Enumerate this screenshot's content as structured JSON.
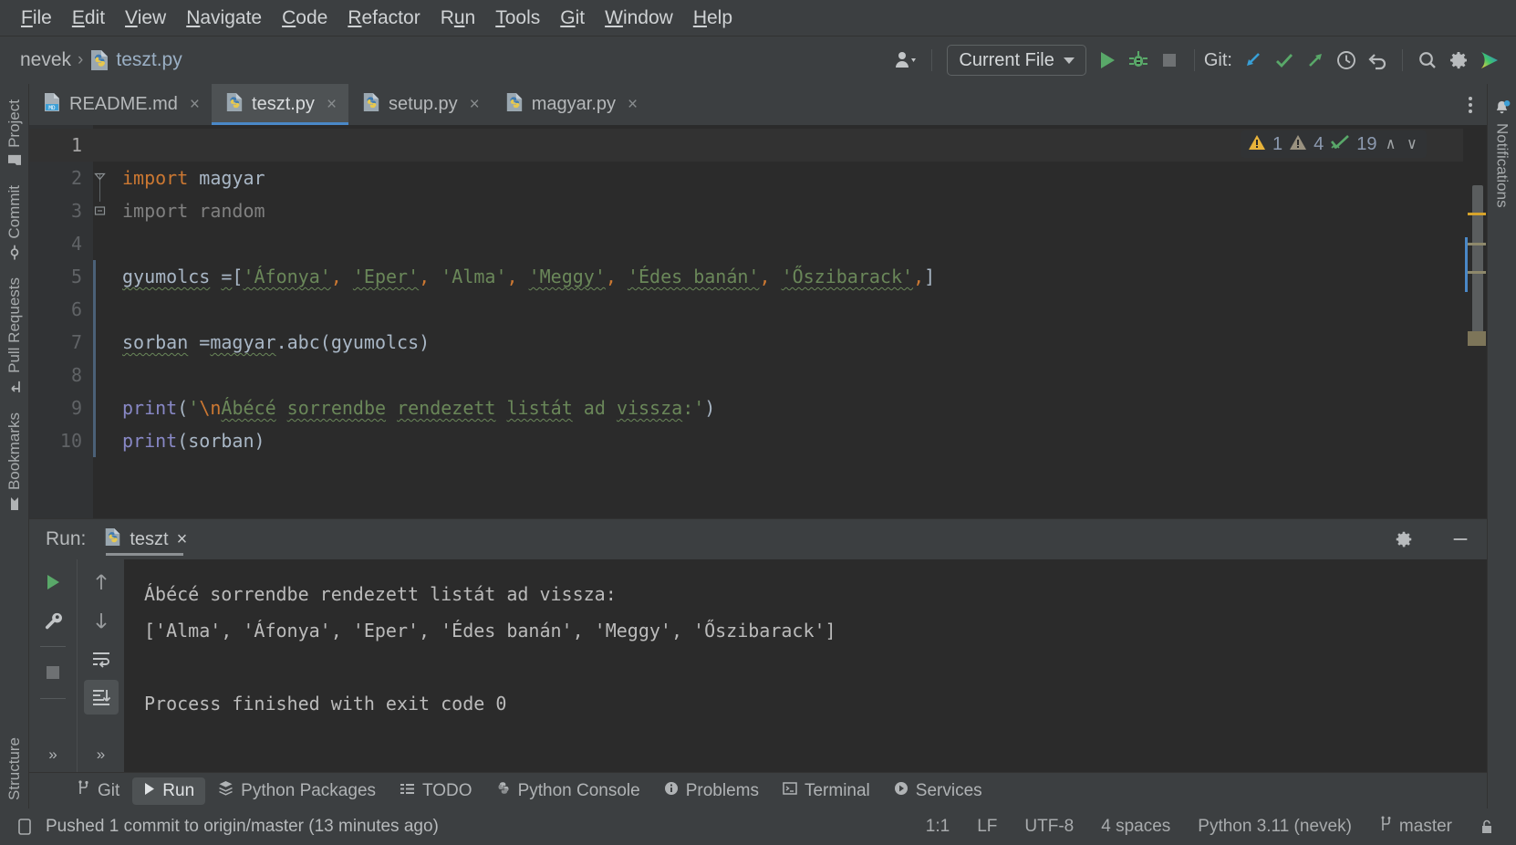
{
  "menubar": {
    "items": [
      {
        "label": "File",
        "mnemonic": "F"
      },
      {
        "label": "Edit",
        "mnemonic": "E"
      },
      {
        "label": "View",
        "mnemonic": "V"
      },
      {
        "label": "Navigate",
        "mnemonic": "N"
      },
      {
        "label": "Code",
        "mnemonic": "C"
      },
      {
        "label": "Refactor",
        "mnemonic": "R"
      },
      {
        "label": "Run",
        "mnemonic": "u"
      },
      {
        "label": "Tools",
        "mnemonic": "T"
      },
      {
        "label": "Git",
        "mnemonic": "G"
      },
      {
        "label": "Window",
        "mnemonic": "W"
      },
      {
        "label": "Help",
        "mnemonic": "H"
      }
    ]
  },
  "toolbar": {
    "breadcrumb": {
      "project": "nevek",
      "separator": "›",
      "file": "teszt.py"
    },
    "run_config": "Current File",
    "git_label": "Git:",
    "icons": {
      "avatar": "user-avatar-icon",
      "run": "run-icon",
      "debug": "debug-icon",
      "stop": "stop-icon",
      "update_project": "git-update-icon",
      "commit": "git-commit-check-icon",
      "push": "git-push-icon",
      "history": "git-history-icon",
      "rollback": "git-rollback-icon",
      "search": "search-everywhere-icon",
      "settings": "settings-gear-icon",
      "assistant": "ai-assistant-icon"
    },
    "colors": {
      "run_green": "#59a869",
      "push_green": "#59a869",
      "update_blue": "#389fd6",
      "accent_blue": "#4a88c7"
    }
  },
  "left_strip": {
    "items": [
      {
        "label": "Project",
        "icon": "project-folder-icon"
      },
      {
        "label": "Commit",
        "icon": "commit-icon"
      },
      {
        "label": "Pull Requests",
        "icon": "pull-request-icon"
      },
      {
        "label": "Bookmarks",
        "icon": "bookmark-icon"
      }
    ],
    "bottom_items": [
      {
        "label": "Structure",
        "icon": "structure-icon"
      }
    ]
  },
  "right_strip": {
    "items": [
      {
        "label": "Notifications",
        "icon": "notifications-bell-icon",
        "badge": true
      }
    ]
  },
  "editor_tabs": [
    {
      "label": "README.md",
      "icon": "markdown-file-icon",
      "active": false,
      "close": "×"
    },
    {
      "label": "teszt.py",
      "icon": "python-file-icon",
      "active": true,
      "close": "×"
    },
    {
      "label": "setup.py",
      "icon": "python-file-icon",
      "active": false,
      "close": "×"
    },
    {
      "label": "magyar.py",
      "icon": "python-file-icon",
      "active": false,
      "close": "×"
    }
  ],
  "inspections": {
    "warnings": "1",
    "weak_warnings": "4",
    "typos": "19",
    "prev": "∧",
    "next": "∨"
  },
  "editor": {
    "filename": "teszt.py",
    "current_line": 1,
    "lines": [
      {
        "n": "1",
        "text": ""
      },
      {
        "n": "2",
        "text": "import magyar"
      },
      {
        "n": "3",
        "text": "import random"
      },
      {
        "n": "4",
        "text": ""
      },
      {
        "n": "5",
        "text": "gyumolcs =['Áfonya', 'Eper', 'Alma', 'Meggy', 'Édes banán', 'Őszibarack',]"
      },
      {
        "n": "6",
        "text": ""
      },
      {
        "n": "7",
        "text": "sorban =magyar.abc(gyumolcs)"
      },
      {
        "n": "8",
        "text": ""
      },
      {
        "n": "9",
        "text": "print('\\nÁbécé sorrendbe rendezett listát ad vissza:')"
      },
      {
        "n": "10",
        "text": "print(sorban)"
      }
    ]
  },
  "run_window": {
    "title": "Run:",
    "tab": "teszt",
    "tab_icon": "python-file-icon",
    "tab_close": "×",
    "settings_icon": "settings-gear-icon",
    "minimize_icon": "minimize-icon",
    "toolbar_icons": [
      "rerun-icon",
      "edit-configurations-wrench-icon",
      "stop-icon",
      "scroll-up-icon",
      "scroll-down-icon",
      "soft-wrap-icon",
      "scroll-to-end-icon"
    ],
    "console": [
      "Ábécé sorrendbe rendezett listát ad vissza:",
      "['Alma', 'Áfonya', 'Eper', 'Édes banán', 'Meggy', 'Őszibarack']",
      "",
      "Process finished with exit code 0"
    ]
  },
  "tool_windows": [
    {
      "label": "Git",
      "icon": "git-branch-icon",
      "active": false
    },
    {
      "label": "Run",
      "icon": "run-triangle-icon",
      "active": true
    },
    {
      "label": "Python Packages",
      "icon": "packages-icon",
      "active": false
    },
    {
      "label": "TODO",
      "icon": "todo-list-icon",
      "active": false
    },
    {
      "label": "Python Console",
      "icon": "python-console-icon",
      "active": false
    },
    {
      "label": "Problems",
      "icon": "problems-icon",
      "active": false
    },
    {
      "label": "Terminal",
      "icon": "terminal-icon",
      "active": false
    },
    {
      "label": "Services",
      "icon": "services-icon",
      "active": false
    }
  ],
  "statusbar": {
    "message_icon": "ide-message-icon",
    "message": "Pushed 1 commit to origin/master (13 minutes ago)",
    "caret": "1:1",
    "line_separator": "LF",
    "encoding": "UTF-8",
    "indent": "4 spaces",
    "interpreter": "Python 3.11 (nevek)",
    "branch_icon": "git-branch-icon",
    "branch": "master",
    "lock_icon": "read-only-lock-icon"
  }
}
